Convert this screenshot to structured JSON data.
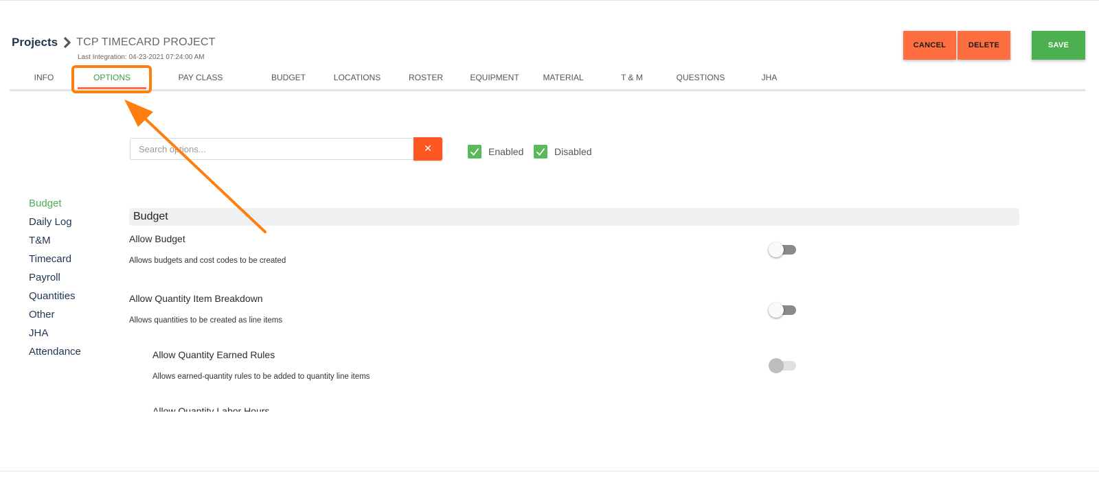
{
  "header": {
    "breadcrumb_root": "Projects",
    "project_name": "TCP TIMECARD PROJECT",
    "last_integration": "Last Integration: 04-23-2021 07:24:00 AM"
  },
  "actions": {
    "cancel_label": "CANCEL",
    "delete_label": "DELETE",
    "save_label": "SAVE"
  },
  "tabs": [
    {
      "label": "INFO"
    },
    {
      "label": "OPTIONS",
      "active": true
    },
    {
      "label": "PAY CLASS"
    },
    {
      "label": "BUDGET"
    },
    {
      "label": "LOCATIONS"
    },
    {
      "label": "ROSTER"
    },
    {
      "label": "EQUIPMENT"
    },
    {
      "label": "MATERIAL"
    },
    {
      "label": "T & M"
    },
    {
      "label": "QUESTIONS"
    },
    {
      "label": "JHA"
    }
  ],
  "search": {
    "placeholder": "Search options...",
    "value": "",
    "clear_glyph": "✕"
  },
  "filters": {
    "enabled_label": "Enabled",
    "enabled_checked": true,
    "disabled_label": "Disabled",
    "disabled_checked": true
  },
  "categories": [
    {
      "label": "Budget",
      "active": true
    },
    {
      "label": "Daily Log"
    },
    {
      "label": "T&M"
    },
    {
      "label": "Timecard"
    },
    {
      "label": "Payroll"
    },
    {
      "label": "Quantities"
    },
    {
      "label": "Other"
    },
    {
      "label": "JHA"
    },
    {
      "label": "Attendance"
    }
  ],
  "section": {
    "title": "Budget",
    "options": [
      {
        "title": "Allow Budget",
        "description": "Allows budgets and cost codes to be created",
        "enabled": false
      },
      {
        "title": "Allow Quantity Item Breakdown",
        "description": "Allows quantities to be created as line items",
        "enabled": false
      },
      {
        "title": "Allow Quantity Earned Rules",
        "description": "Allows earned-quantity rules to be added to quantity line items",
        "enabled": false,
        "disabled_control": true
      },
      {
        "title": "Allow Quantity Labor Hours"
      }
    ]
  },
  "colors": {
    "accent_orange": "#ff6e40",
    "save_green": "#4caf50",
    "active_tab": "#3a9a3f",
    "annotation": "#ff7f0e"
  },
  "icons": {
    "breadcrumb_separator": "chevron-right-icon",
    "checkbox": "check-icon"
  }
}
